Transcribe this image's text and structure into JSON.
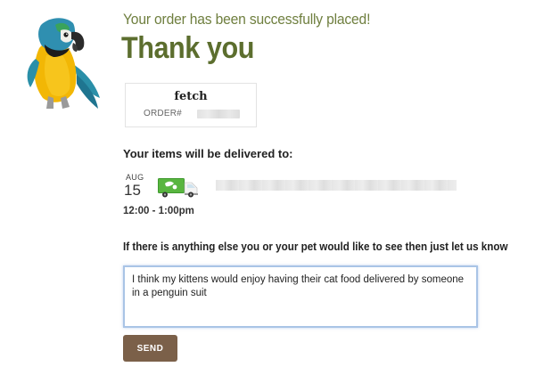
{
  "header": {
    "subtitle": "Your order has been successfully placed!",
    "title": "Thank you"
  },
  "order": {
    "brand": "fetch",
    "order_label": "ORDER#"
  },
  "delivery": {
    "label": "Your items will be delivered to:",
    "month": "AUG",
    "day": "15",
    "time": "12:00 - 1:00pm",
    "truck_icon": "delivery-truck-icon"
  },
  "feedback": {
    "prompt": "If there is anything else you or your pet would like to see then just let us know",
    "message": "I think my kittens would enjoy having their cat food delivered by someone in a penguin suit",
    "send_label": "SEND"
  },
  "colors": {
    "title_green": "#5c6e2e",
    "subtitle_green": "#6f7f3f",
    "send_brown": "#7b6049",
    "focus_blue": "#a9c4e6"
  }
}
